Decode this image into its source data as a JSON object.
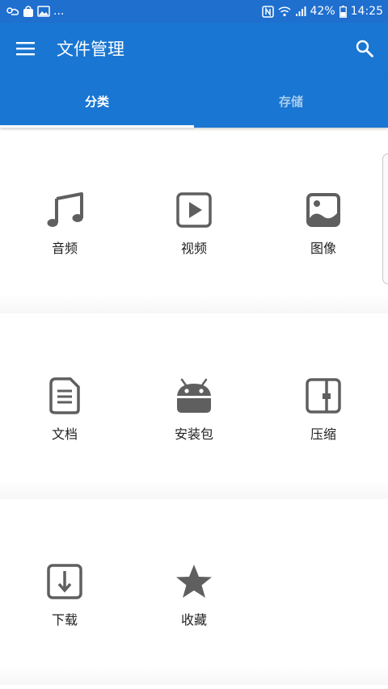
{
  "status_bar": {
    "dots": "...",
    "battery_pct": "42%",
    "time": "14:25"
  },
  "app_bar": {
    "title": "文件管理"
  },
  "tabs": [
    {
      "label": "分类",
      "selected": true
    },
    {
      "label": "存储",
      "selected": false
    }
  ],
  "categories": [
    {
      "label": "音频",
      "icon": "music-note-icon"
    },
    {
      "label": "视频",
      "icon": "video-play-icon"
    },
    {
      "label": "图像",
      "icon": "image-icon"
    },
    {
      "label": "文档",
      "icon": "document-icon"
    },
    {
      "label": "安装包",
      "icon": "android-icon"
    },
    {
      "label": "压缩",
      "icon": "archive-icon"
    },
    {
      "label": "下载",
      "icon": "download-icon"
    },
    {
      "label": "收藏",
      "icon": "star-icon"
    }
  ],
  "colors": {
    "primary": "#1976d2",
    "status_bar": "#1f6fcf",
    "icon": "#5f5f5f"
  }
}
